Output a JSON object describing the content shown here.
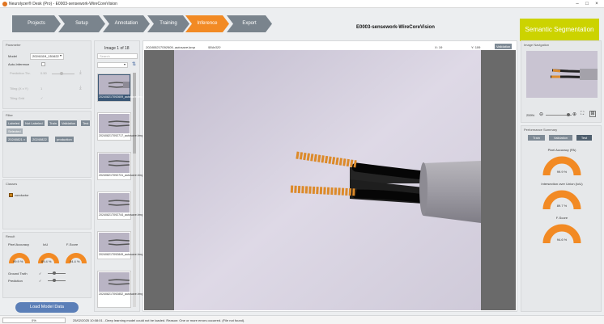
{
  "window": {
    "title": "Neurolyzer® Desk (Pro) - E0003-sensework-WireCoreVision"
  },
  "steps": [
    "Projects",
    "Setup",
    "Annotation",
    "Training",
    "Inference",
    "Export"
  ],
  "active_step": "Inference",
  "project_name": "E0003-sensework-WireCoreVision",
  "mode_button": "Semantic Segmentation",
  "parameter": {
    "title": "Parameter",
    "model_label": "Model",
    "model_value": "20241119_151622",
    "auto_inference": "Auto-Inference",
    "prediction_thr_label": "Prediction Thr.",
    "prediction_thr_value": "0.50",
    "tiling_label": "Tiling (X x Y)",
    "tiling_value": "1",
    "tiling_grid": "Tiling Grid"
  },
  "filter": {
    "title": "Filter",
    "tags": [
      "Labeled",
      "Not Labeled",
      "Train",
      "Validation",
      "Test"
    ],
    "selected_label": "Selected",
    "selected_tags": [
      "20240821 ×",
      "20240822",
      "production"
    ]
  },
  "classes": {
    "title": "Classes",
    "items": [
      {
        "name": "conductor",
        "color": "#c88018"
      }
    ]
  },
  "result": {
    "title": "Result",
    "labels": [
      "Pixel Accuracy",
      "IoU",
      "F-Score"
    ],
    "values": [
      "99.9 %",
      "89.4 %",
      "94.4 %"
    ],
    "ground_truth": "Ground Truth",
    "prediction": "Prediction"
  },
  "load_button": "Load Model Data",
  "images": {
    "label": "Image",
    "current": "1",
    "of": "of",
    "total": "18",
    "search_placeholder": "Search",
    "thumbs": [
      "20240821T092609_autosave.bmp",
      "20240821T092717_autosave.bmp",
      "20240821T092731_autosave.bmp",
      "20240821T092744_autosave.bmp",
      "20240821T092849_autosave.bmp",
      "20240821T092852_autosave.bmp"
    ]
  },
  "viewer": {
    "filename": "20240821T092609_autosave.bmp",
    "size": "584x320",
    "x_label": "X:",
    "x_value": "19",
    "y_label": "Y:",
    "y_value": "109",
    "validation_tag": "Validation"
  },
  "navigation": {
    "title": "Image Navigation",
    "zoom": "259%"
  },
  "performance": {
    "title": "Performance Summary",
    "tabs": [
      "Train",
      "Validation",
      "Test"
    ],
    "metrics": [
      {
        "label": "Pixel Accuracy (PA)",
        "value": "99.9 %",
        "fraction": 0.999
      },
      {
        "label": "Intersection over Union (IoU)",
        "value": "89.7 %",
        "fraction": 0.897
      },
      {
        "label": "F-Score",
        "value": "94.6 %",
        "fraction": 0.946
      }
    ]
  },
  "status": {
    "progress": "0%",
    "message": "25/02/2025 10:08:01 - Deep learning model could not be loaded. Reason: One or more errors occurred. (File not found)."
  },
  "colors": {
    "accent": "#f28a24",
    "step": "#7a848d",
    "segment": "#ccd300",
    "tag": "#7e8a95"
  }
}
